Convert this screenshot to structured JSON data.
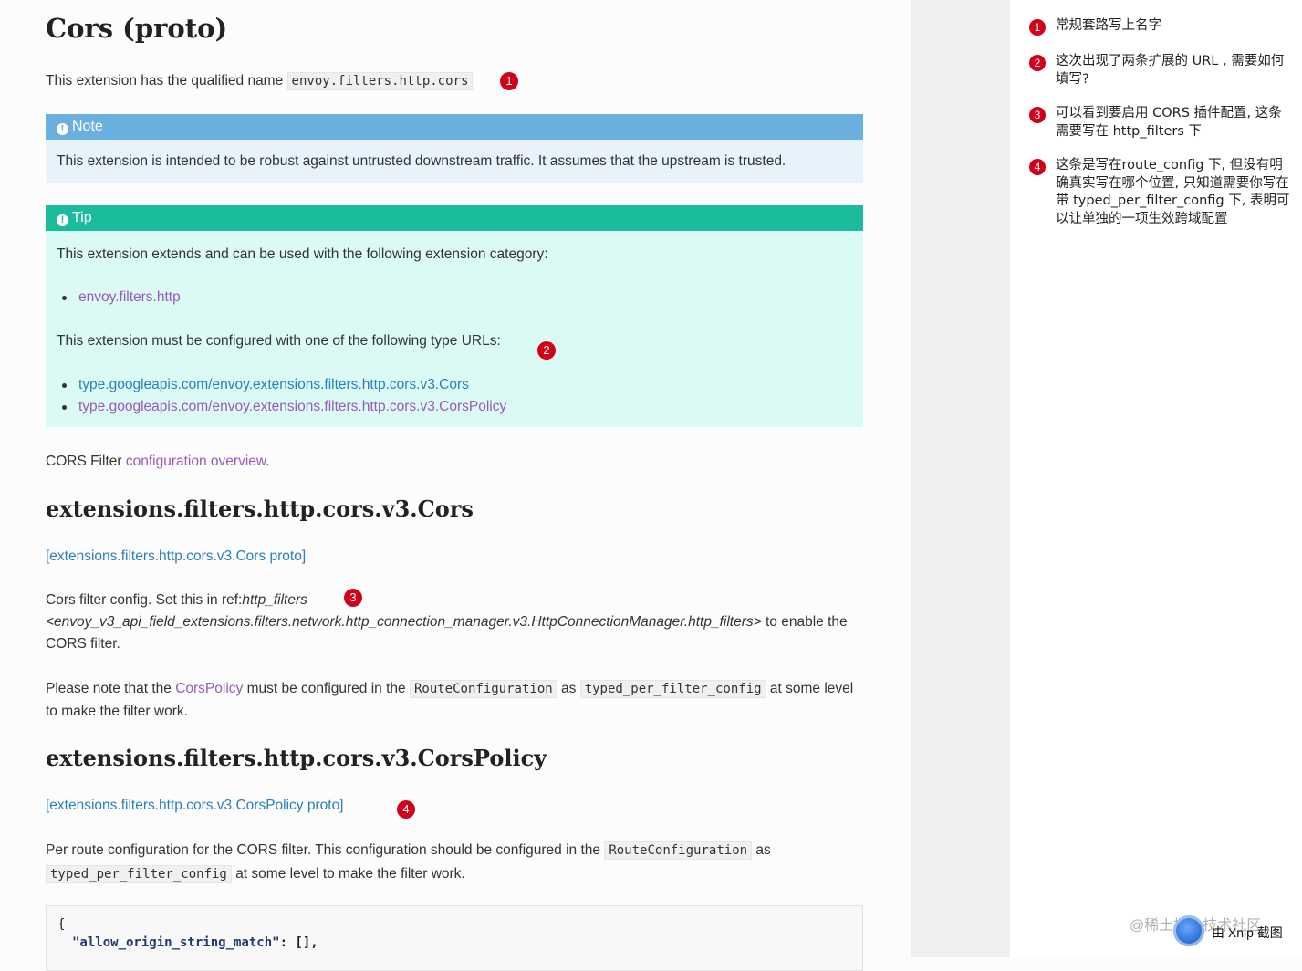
{
  "page_title": "Cors (proto)",
  "intro": {
    "text": "This extension has the qualified name",
    "code": "envoy.filters.http.cors"
  },
  "note": {
    "heading": "Note",
    "body": "This extension is intended to be robust against untrusted downstream traffic. It assumes that the upstream is trusted."
  },
  "tip": {
    "heading": "Tip",
    "category_text": "This extension extends and can be used with the following extension category:",
    "categories": [
      "envoy.filters.http"
    ],
    "type_urls_text": "This extension must be configured with one of the following type URLs:",
    "type_urls": [
      "type.googleapis.com/envoy.extensions.filters.http.cors.v3.Cors",
      "type.googleapis.com/envoy.extensions.filters.http.cors.v3.CorsPolicy"
    ]
  },
  "overview": {
    "prefix": "CORS Filter",
    "link": "configuration overview",
    "suffix": "."
  },
  "section_cors": {
    "heading": "extensions.filters.http.cors.v3.Cors",
    "proto_link": "[extensions.filters.http.cors.v3.Cors proto]",
    "p1_a": "Cors filter config. Set this in ref:",
    "p1_em1": "http_filters",
    "p1_em2": "<envoy_v3_api_field_extensions.filters.network.http_connection_manager.v3.HttpConnectionManager.http_filters>",
    "p1_b": "to enable the",
    "p1_c": "CORS filter.",
    "p2_a": "Please note that the",
    "p2_link": "CorsPolicy",
    "p2_b": "must be configured in the",
    "p2_code1": "RouteConfiguration",
    "p2_c": "as",
    "p2_code2": "typed_per_filter_config",
    "p2_d": "at some level",
    "p2_e": "to make the filter work."
  },
  "section_policy": {
    "heading": "extensions.filters.http.cors.v3.CorsPolicy",
    "proto_link": "[extensions.filters.http.cors.v3.CorsPolicy proto]",
    "p_a": "Per route configuration for the CORS filter. This configuration should be configured in the",
    "p_code1": "RouteConfiguration",
    "p_b": "as",
    "p_code2": "typed_per_filter_config",
    "p_c": "at some level to make the filter work."
  },
  "code": {
    "line1": "{",
    "line2_key": "\"allow_origin_string_match\"",
    "line2_rest": ": [],"
  },
  "markers": [
    "1",
    "2",
    "3",
    "4"
  ],
  "annotations": [
    {
      "num": "1",
      "text": "常规套路写上名字"
    },
    {
      "num": "2",
      "text": "这次出现了两条扩展的 URL , 需要如何填写?"
    },
    {
      "num": "3",
      "text": "可以看到要启用 CORS 插件配置, 这条需要写在 http_filters 下"
    },
    {
      "num": "4",
      "text": "这条是写在route_config 下, 但没有明确真实写在哪个位置, 只知道需要你写在带 typed_per_filter_config 下, 表明可以让单独的一项生效跨域配置"
    }
  ],
  "watermark": "@稀土掘金技术社区",
  "xnip_label": "由 Xnip 截图",
  "colors": {
    "note_header": "#6ab0de",
    "note_body": "#e7f2fa",
    "tip_header": "#1abc9c",
    "tip_body": "#dbfaf4",
    "link": "#2980b9",
    "visited_link": "#9b59b6",
    "marker": "#d0021b"
  }
}
